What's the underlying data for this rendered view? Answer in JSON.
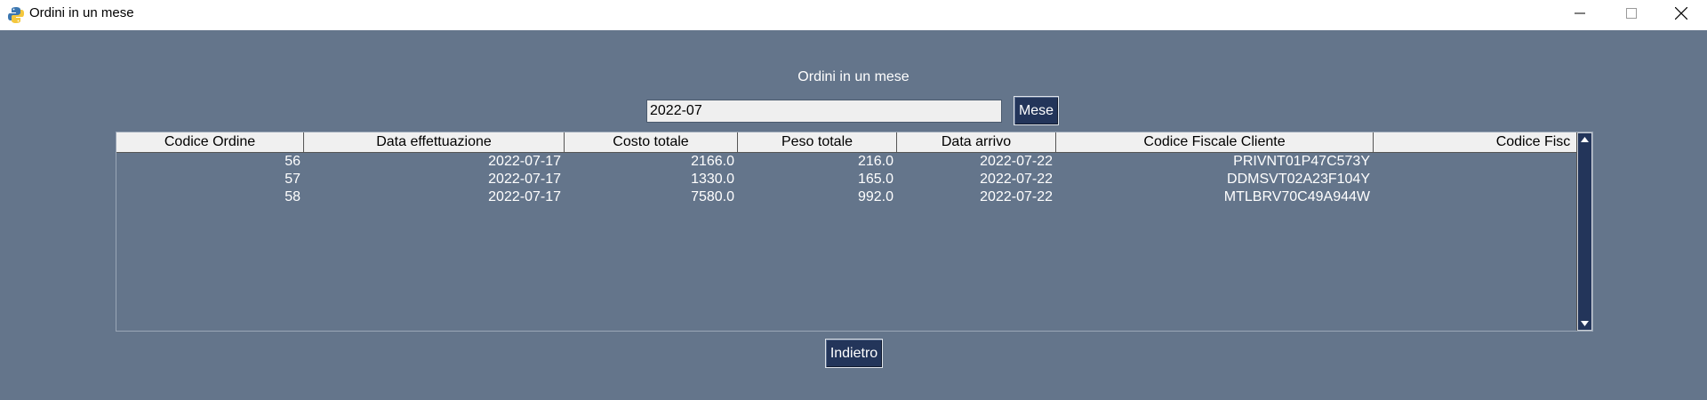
{
  "window": {
    "title": "Ordini in un mese",
    "icon": "python-icon",
    "controls": [
      "minimize-icon",
      "maximize-icon",
      "close-icon"
    ]
  },
  "heading": "Ordini in un mese",
  "search": {
    "value": "2022-07",
    "button_label": "Mese"
  },
  "table": {
    "columns": [
      "Codice Ordine",
      "Data effettuazione",
      "Costo totale",
      "Peso totale",
      "Data arrivo",
      "Codice Fiscale Cliente",
      "Codice Fisc"
    ],
    "rows": [
      [
        "56",
        "2022-07-17",
        "2166.0",
        "216.0",
        "2022-07-22",
        "PRIVNT01P47C573Y",
        ""
      ],
      [
        "57",
        "2022-07-17",
        "1330.0",
        "165.0",
        "2022-07-22",
        "DDMSVT02A23F104Y",
        ""
      ],
      [
        "58",
        "2022-07-17",
        "7580.0",
        "992.0",
        "2022-07-22",
        "MTLBRV70C49A944W",
        ""
      ]
    ]
  },
  "back_button_label": "Indietro",
  "colors": {
    "background": "#64758b",
    "button": "#23355a",
    "header": "#f0f0f0"
  }
}
